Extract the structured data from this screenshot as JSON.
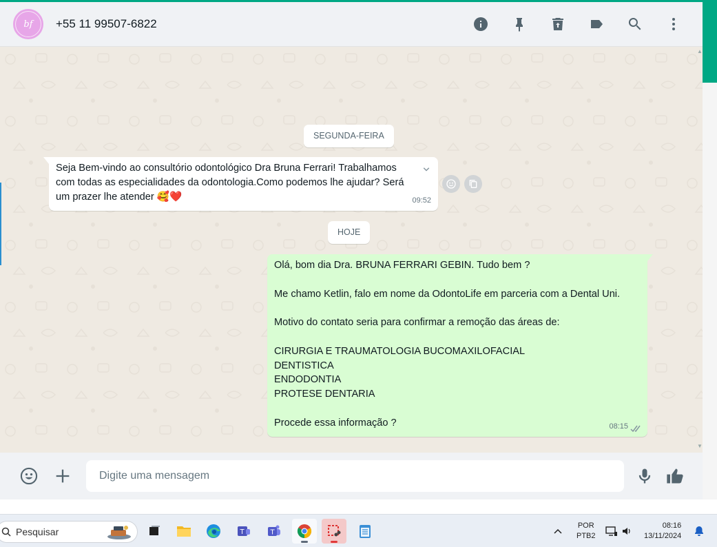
{
  "header": {
    "avatar_initials": "bf",
    "contact_name": "+55 11 99507-6822",
    "icons": [
      "info-icon",
      "pin-icon",
      "trash-icon",
      "label-icon",
      "search-icon",
      "more-icon"
    ]
  },
  "chat": {
    "date_chips": [
      "SEGUNDA-FEIRA",
      "HOJE"
    ],
    "incoming": {
      "lines": [
        "Seja Bem-vindo ao consultório odontológico Dra Bruna Ferrari! Trabalhamos",
        "com todas as especialidades da odontologia.Como podemos lhe ajudar? Será",
        "um prazer lhe atender 🥰❤️"
      ],
      "time": "09:52"
    },
    "outgoing": {
      "lines": [
        "Olá, bom dia Dra. BRUNA FERRARI GEBIN. Tudo bem ?",
        "",
        "Me chamo Ketlin, falo em nome da OdontoLife em parceria com a Dental Uni.",
        "",
        "Motivo do contato seria para confirmar a remoção das áreas de:",
        "",
        "CIRURGIA E TRAUMATOLOGIA BUCOMAXILOFACIAL",
        "DENTISTICA",
        "ENDODONTIA",
        "PROTESE DENTARIA",
        "",
        "Procede essa informação ?"
      ],
      "time": "08:15",
      "status": "double-check-icon"
    }
  },
  "composer": {
    "placeholder": "Digite uma mensagem"
  },
  "taskbar": {
    "search_label": "Pesquisar",
    "language": "POR",
    "layout": "PTB2",
    "time": "08:16",
    "date": "13/11/2024"
  },
  "colors": {
    "accent": "#00a884",
    "outgoing_bubble": "#d9fdd3",
    "chat_bg": "#efeae2"
  }
}
